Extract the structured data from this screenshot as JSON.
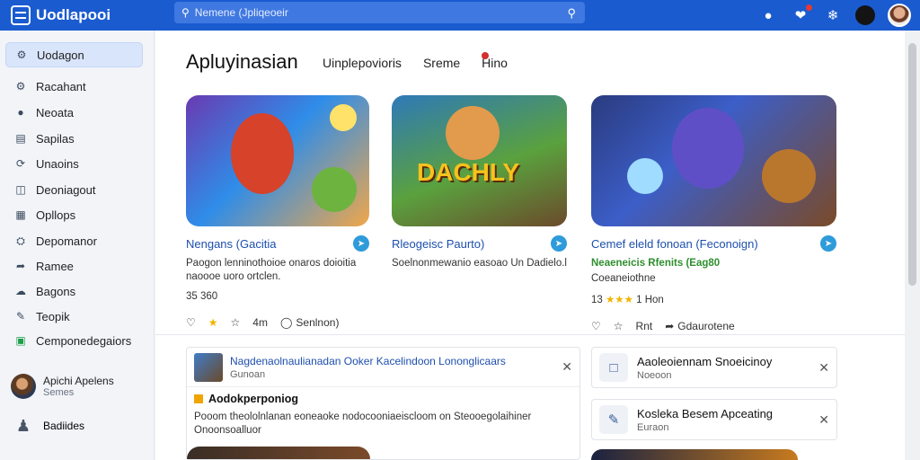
{
  "app": {
    "name": "Uodlapooi"
  },
  "search": {
    "placeholder": "Nemene (Jpliqeoeir"
  },
  "topbar_icons": [
    "user-icon",
    "notifications-icon",
    "settings-icon"
  ],
  "sidebar": {
    "items": [
      {
        "label": "Uodagon",
        "icon": "home-icon",
        "active": true
      },
      {
        "label": "Racahant",
        "icon": "gear-icon"
      },
      {
        "label": "Neoata",
        "icon": "user-icon"
      },
      {
        "label": "Sapilas",
        "icon": "chart-icon"
      },
      {
        "label": "Unaoins",
        "icon": "refresh-icon"
      },
      {
        "label": "Deoniagout",
        "icon": "document-icon"
      },
      {
        "label": "Opllops",
        "icon": "grid-icon"
      },
      {
        "label": "Depomanor",
        "icon": "settings-icon"
      },
      {
        "label": "Ramee",
        "icon": "share-icon"
      },
      {
        "label": "Bagons",
        "icon": "upload-icon"
      },
      {
        "label": "Teopik",
        "icon": "edit-icon"
      },
      {
        "label": "Cemponedegaiors",
        "icon": "spreadsheet-icon"
      }
    ],
    "profile": {
      "name": "Apichi Apelens",
      "sub": "Semes"
    },
    "footer": {
      "label": "Badiides"
    }
  },
  "main": {
    "title": "Apluyinasian",
    "tabs": [
      "Uinplepovioris",
      "Sreme",
      "Hino"
    ],
    "cards": [
      {
        "title": "Nengans (Gacitia",
        "desc": "Paogon lenninothoioe onaros doioitia naoooe uoro ortclen.",
        "stats": "35 360",
        "actions": [
          "4m",
          "Senlnon)"
        ]
      },
      {
        "title": "Rleogeisc Paurto)",
        "desc": "Soelnonmewanio easoao Un Dadielo.l",
        "stats": "",
        "art_text": "DACHLY",
        "actions": []
      },
      {
        "title": "Cemef eleld fonoan (Feconoign)",
        "subtitle": "Neaeneicis Rfenits (Eag80",
        "desc": "Coeaneiothne",
        "stats": "13",
        "stats_suffix": "1 Hon",
        "rating": 3,
        "actions": [
          "Rnt",
          "Gdaurotene"
        ]
      }
    ],
    "feed": {
      "header": "Nagdenaolnaulianadan Ooker Kacelindoon Lononglicaars",
      "header_sub": "Gunoan",
      "body_title": "Aodokperponiog",
      "body_text": "Pooom theololnlanan eoneaoke nodocooniaeiscloom on Steooegolaihiner Onoonsoalluor"
    },
    "side_cards": [
      {
        "name": "Aaoleoiennam Snoeicinoy",
        "sub": "Noeoon",
        "icon": "clipboard-icon"
      },
      {
        "name": "Kosleka Besem Apceating",
        "sub": "Euraon",
        "icon": "gamepad-icon"
      }
    ]
  },
  "colors": {
    "primary": "#1a5bd0",
    "link": "#1d4fae",
    "accent": "#2e9bdb",
    "star": "#f0b400"
  }
}
